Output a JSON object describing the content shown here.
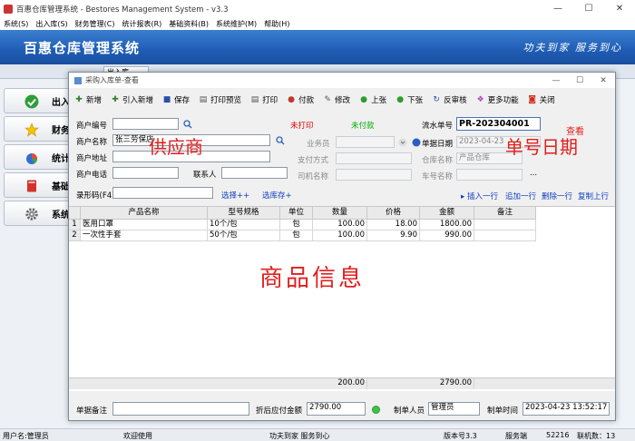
{
  "app": {
    "title": "百惠仓库管理系统 - Bestores Management System - v3.3",
    "menu": [
      "系统(S)",
      "出入库(S)",
      "财务管理(C)",
      "统计报表(R)",
      "基础资料(B)",
      "系统维护(M)",
      "帮助(H)"
    ],
    "banner_title": "百惠仓库管理系统",
    "slogan": "功夫到家 服务到心",
    "tab_label": "出入库",
    "window_controls": [
      "—",
      "☐",
      "✕"
    ]
  },
  "sidebar": {
    "items": [
      {
        "label": "出入库",
        "icon": "check-icon"
      },
      {
        "label": "财务管理",
        "icon": "star-icon"
      },
      {
        "label": "统计报表",
        "icon": "pie-chart-icon"
      },
      {
        "label": "基础资料",
        "icon": "book-icon"
      },
      {
        "label": "系统维护",
        "icon": "gear-icon"
      }
    ]
  },
  "dialog": {
    "title": "采购入库单-查看",
    "controls": [
      "—",
      "☐",
      "✕"
    ],
    "toolbar": [
      {
        "label": "新增",
        "icon": "plus-icon",
        "glyph": "✚",
        "color": "#2f7d2f"
      },
      {
        "label": "引入新增",
        "icon": "import-icon",
        "glyph": "✚",
        "color": "#2f7d2f"
      },
      {
        "label": "保存",
        "icon": "save-icon",
        "glyph": "■",
        "color": "#2c4fa8"
      },
      {
        "label": "打印预览",
        "icon": "print-preview-icon",
        "glyph": "▤",
        "color": "#555555"
      },
      {
        "label": "打印",
        "icon": "print-icon",
        "glyph": "▤",
        "color": "#555555"
      },
      {
        "label": "付款",
        "icon": "payment-icon",
        "glyph": "●",
        "color": "#c0392b"
      },
      {
        "label": "修改",
        "icon": "edit-icon",
        "glyph": "✎",
        "color": "#555555"
      },
      {
        "label": "上张",
        "icon": "prev-icon",
        "glyph": "●",
        "color": "#2e9c2e"
      },
      {
        "label": "下张",
        "icon": "next-icon",
        "glyph": "●",
        "color": "#2e9c2e"
      },
      {
        "label": "反审核",
        "icon": "unapprove-icon",
        "glyph": "↻",
        "color": "#2c4fa8"
      },
      {
        "label": "更多功能",
        "icon": "more-icon",
        "glyph": "❖",
        "color": "#b23fb2"
      },
      {
        "label": "关闭",
        "icon": "close-icon",
        "glyph": "◙",
        "color": "#d0301e"
      }
    ],
    "form": {
      "supplier_code_label": "商户编号",
      "supplier_code": "",
      "supplier_name_label": "商户名称",
      "supplier_name": "张三劳保店",
      "address_label": "商户地址",
      "address": "",
      "phone_label": "商户电话",
      "phone": "",
      "contact_label": "联系人",
      "contact": "",
      "print_status": "未打印",
      "pay_status": "未付款",
      "salesman_label": "业务员",
      "pay_method_label": "支付方式",
      "driver_label": "司机名称",
      "serial_label": "流水单号",
      "serial_no": "PR-202304001",
      "date_label": "单据日期",
      "date": "2023-04-23",
      "warehouse_label": "仓库名称",
      "warehouse": "产品仓库",
      "plate_label": "车号名称",
      "plate_more": "...",
      "barcode_label": "录形码(F4)",
      "select_link": "选择++",
      "select_stock_link": "选库存+",
      "insert_row": "插入一行",
      "append_row": "追加一行",
      "delete_row": "删除一行",
      "copy_row": "复制上行"
    },
    "annotations": {
      "supplier": "供应商",
      "serial_date": "单号日期",
      "view": "查看",
      "goods": "商品信息"
    },
    "table": {
      "headers": [
        "",
        "产品名称",
        "型号规格",
        "单位",
        "数量",
        "价格",
        "金额",
        "备注"
      ],
      "rows": [
        [
          "1",
          "医用口罩",
          "10个/包",
          "包",
          "100.00",
          "18.00",
          "1800.00",
          ""
        ],
        [
          "2",
          "一次性手套",
          "50个/包",
          "包",
          "100.00",
          "9.90",
          "990.00",
          ""
        ]
      ],
      "totals": {
        "qty": "200.00",
        "amount": "2790.00"
      }
    },
    "bottom": {
      "remark_label": "单据备注",
      "remark": "",
      "payable_label": "折后应付金额",
      "payable": "2790.00",
      "maker_label": "制单人员",
      "maker": "管理员",
      "time_label": "制单时间",
      "time": "2023-04-23 13:52:17"
    }
  },
  "status": {
    "user": "用户名:管理员",
    "welcome": "欢迎使用",
    "slogan": "功夫到家 服务到心",
    "version": "版本号3.3",
    "service": "服务端",
    "port": "52216",
    "connections": "联机数：13"
  }
}
